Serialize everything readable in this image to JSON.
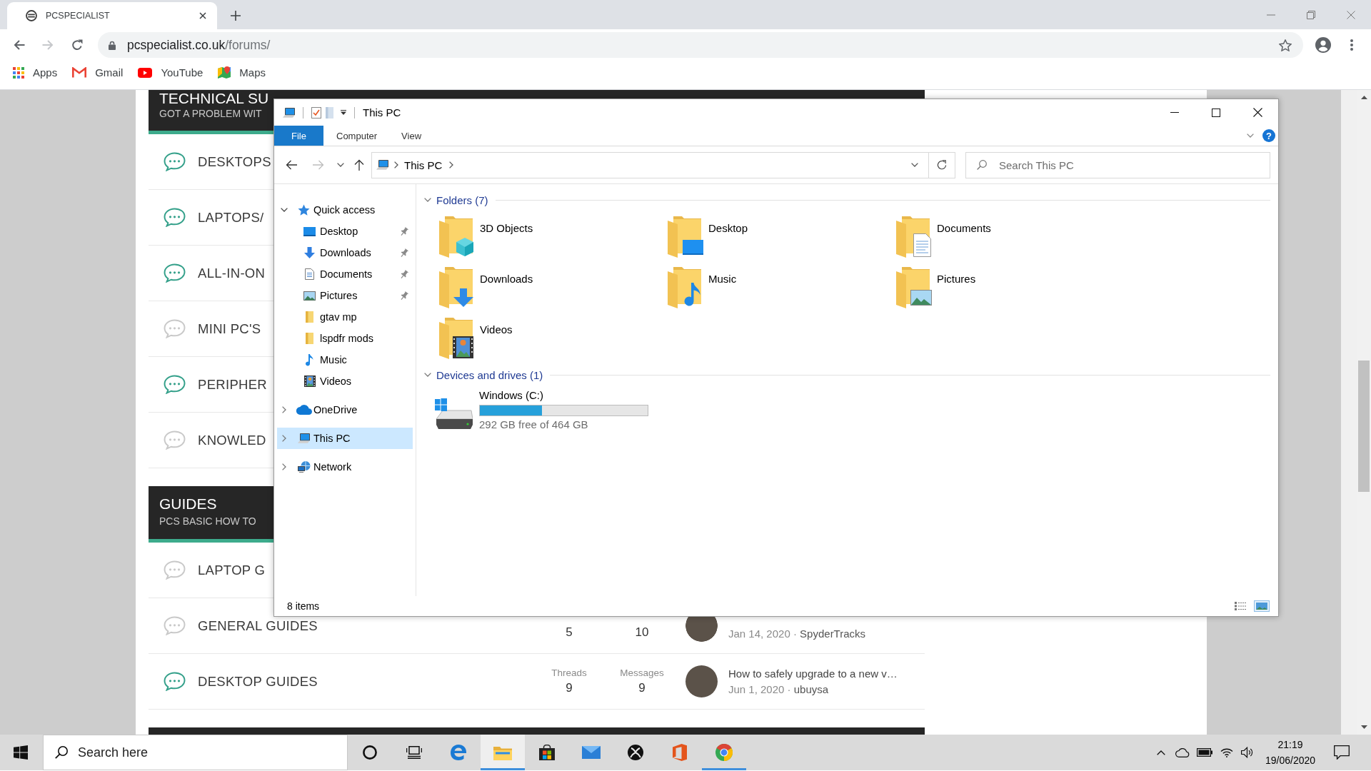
{
  "browser": {
    "tab": {
      "title": "PCSPECIALIST"
    },
    "toolbar": {
      "forward_disabled": true
    },
    "address": {
      "host": "pcspecialist.co.uk",
      "path": "/forums/"
    },
    "bookmarks": [
      {
        "kind": "apps",
        "label": "Apps"
      },
      {
        "kind": "gmail",
        "label": "Gmail"
      },
      {
        "kind": "youtube",
        "label": "YouTube"
      },
      {
        "kind": "maps",
        "label": "Maps"
      }
    ]
  },
  "page": {
    "sections": [
      {
        "title": "TECHNICAL SU",
        "subtitle": "GOT A PROBLEM WIT",
        "forums": [
          {
            "label": "DESKTOPS",
            "unread": true
          },
          {
            "label": "LAPTOPS/",
            "unread": true
          },
          {
            "label": "ALL-IN-ON",
            "unread": true
          },
          {
            "label": "MINI PC'S",
            "unread": false
          },
          {
            "label": "PERIPHER",
            "unread": true
          },
          {
            "label": "KNOWLED",
            "unread": false
          }
        ]
      },
      {
        "title": "GUIDES",
        "subtitle": "PCS BASIC HOW TO",
        "forums": [
          {
            "label": "LAPTOP G",
            "unread": false
          },
          {
            "label": "GENERAL GUIDES",
            "unread": false,
            "stats": {
              "threads": "5",
              "messages": "10",
              "date": "Jan 14, 2020",
              "separator": "·",
              "user": "SpyderTracks"
            }
          },
          {
            "label": "DESKTOP GUIDES",
            "unread": true,
            "stats": {
              "threads_label": "Threads",
              "threads": "9",
              "messages_label": "Messages",
              "messages": "9",
              "latest": "How to safely upgrade to a new v…",
              "date": "Jun 1, 2020",
              "separator": "·",
              "user": "ubuysa"
            }
          }
        ]
      }
    ]
  },
  "explorer": {
    "title": "This PC",
    "ribbon_tabs": [
      {
        "kind": "file",
        "label": "File"
      },
      {
        "kind": "tab",
        "label": "Computer"
      },
      {
        "kind": "tab",
        "label": "View"
      }
    ],
    "help": "?",
    "forward_disabled": true,
    "breadcrumb": [
      "This PC"
    ],
    "search": {
      "placeholder": "Search This PC"
    },
    "nav": [
      {
        "kind": "quick",
        "label": "Quick access",
        "expanded": true,
        "selected": false,
        "children": [
          {
            "kind": "desktop",
            "label": "Desktop",
            "pinned": true,
            "selected": false
          },
          {
            "kind": "downloads",
            "label": "Downloads",
            "pinned": true,
            "selected": false
          },
          {
            "kind": "documents",
            "label": "Documents",
            "pinned": true,
            "selected": false
          },
          {
            "kind": "pictures",
            "label": "Pictures",
            "pinned": true,
            "selected": false
          },
          {
            "kind": "folder",
            "label": "gtav mp",
            "pinned": false,
            "selected": false
          },
          {
            "kind": "folder",
            "label": "lspdfr mods",
            "pinned": false,
            "selected": false
          },
          {
            "kind": "music",
            "label": "Music",
            "pinned": false,
            "selected": false
          },
          {
            "kind": "videos",
            "label": "Videos",
            "pinned": false,
            "selected": false
          }
        ]
      },
      {
        "kind": "onedrive",
        "label": "OneDrive",
        "expanded": false,
        "selected": false
      },
      {
        "kind": "pc",
        "label": "This PC",
        "expanded": false,
        "selected": true
      },
      {
        "kind": "network",
        "label": "Network",
        "expanded": false,
        "selected": false
      }
    ],
    "groups": [
      {
        "kind": "folders",
        "title": "Folders (7)",
        "expanded": true,
        "items": [
          {
            "kind": "objects",
            "name": "3D Objects",
            "selected": false
          },
          {
            "kind": "desktop",
            "name": "Desktop",
            "selected": false
          },
          {
            "kind": "documents",
            "name": "Documents",
            "selected": false
          },
          {
            "kind": "downloads",
            "name": "Downloads",
            "selected": false
          },
          {
            "kind": "music",
            "name": "Music",
            "selected": false
          },
          {
            "kind": "pictures",
            "name": "Pictures",
            "selected": false
          },
          {
            "kind": "videos",
            "name": "Videos",
            "selected": false
          }
        ]
      },
      {
        "kind": "drives",
        "title": "Devices and drives (1)",
        "expanded": true,
        "items": [
          {
            "kind": "windows",
            "name": "Windows (C:)",
            "selected": false,
            "level": 0.37,
            "free": "292 GB free of 464 GB"
          }
        ]
      }
    ],
    "status": "8 items",
    "views": [
      {
        "kind": "details",
        "selected": false
      },
      {
        "kind": "large",
        "selected": true
      }
    ]
  },
  "taskbar": {
    "search": {
      "placeholder": "Search here"
    },
    "apps": [
      {
        "kind": "cortana",
        "running": false,
        "active": false
      },
      {
        "kind": "taskview",
        "running": false,
        "active": false
      },
      {
        "kind": "edge",
        "running": false,
        "active": false
      },
      {
        "kind": "explorer",
        "running": true,
        "active": true
      },
      {
        "kind": "store",
        "running": false,
        "active": false
      },
      {
        "kind": "mail",
        "running": false,
        "active": false
      },
      {
        "kind": "xbox",
        "running": false,
        "active": false
      },
      {
        "kind": "office",
        "running": false,
        "active": false
      },
      {
        "kind": "chrome",
        "running": true,
        "active": false
      }
    ],
    "clock": {
      "time": "21:19",
      "date": "19/06/2020"
    }
  }
}
